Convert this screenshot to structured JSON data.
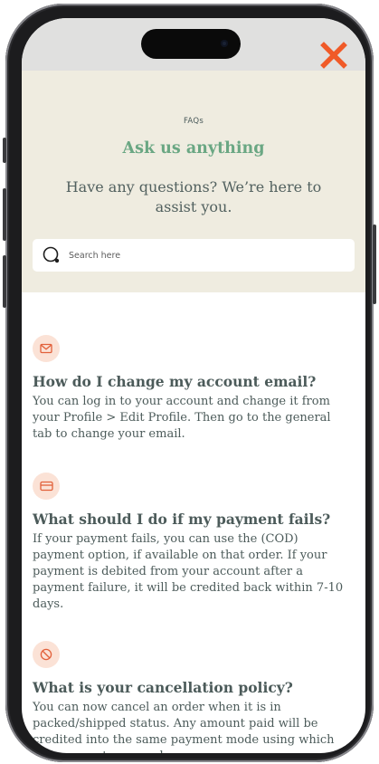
{
  "header": {
    "eyebrow": "FAQs",
    "title": "Ask us anything",
    "subtitle": "Have any questions? We’re here to assist you."
  },
  "search": {
    "placeholder": "Search here",
    "value": ""
  },
  "colors": {
    "accent_green": "#6aa783",
    "close_orange": "#f05a28",
    "icon_bg": "#fbe2d6",
    "icon_stroke": "#e2603a",
    "hero_bg": "#efece0",
    "text": "#4c5b5a"
  },
  "faqs": [
    {
      "icon": "mail-icon",
      "question": "How do I change my account email?",
      "answer": "You can log in to your account and change it from your Profile > Edit Profile. Then go to the general tab to change your email."
    },
    {
      "icon": "credit-card-icon",
      "question": "What should I do if my payment fails?",
      "answer": "If your payment fails, you can use the (COD) payment option, if available on that order. If your payment is debited from your account after a payment failure, it will be credited back within 7-10 days."
    },
    {
      "icon": "cancel-icon",
      "question": "What is your cancellation policy?",
      "answer": "You can now cancel an order when it is in packed/shipped status. Any amount paid will be credited into the same payment mode using which the payment was made."
    }
  ]
}
